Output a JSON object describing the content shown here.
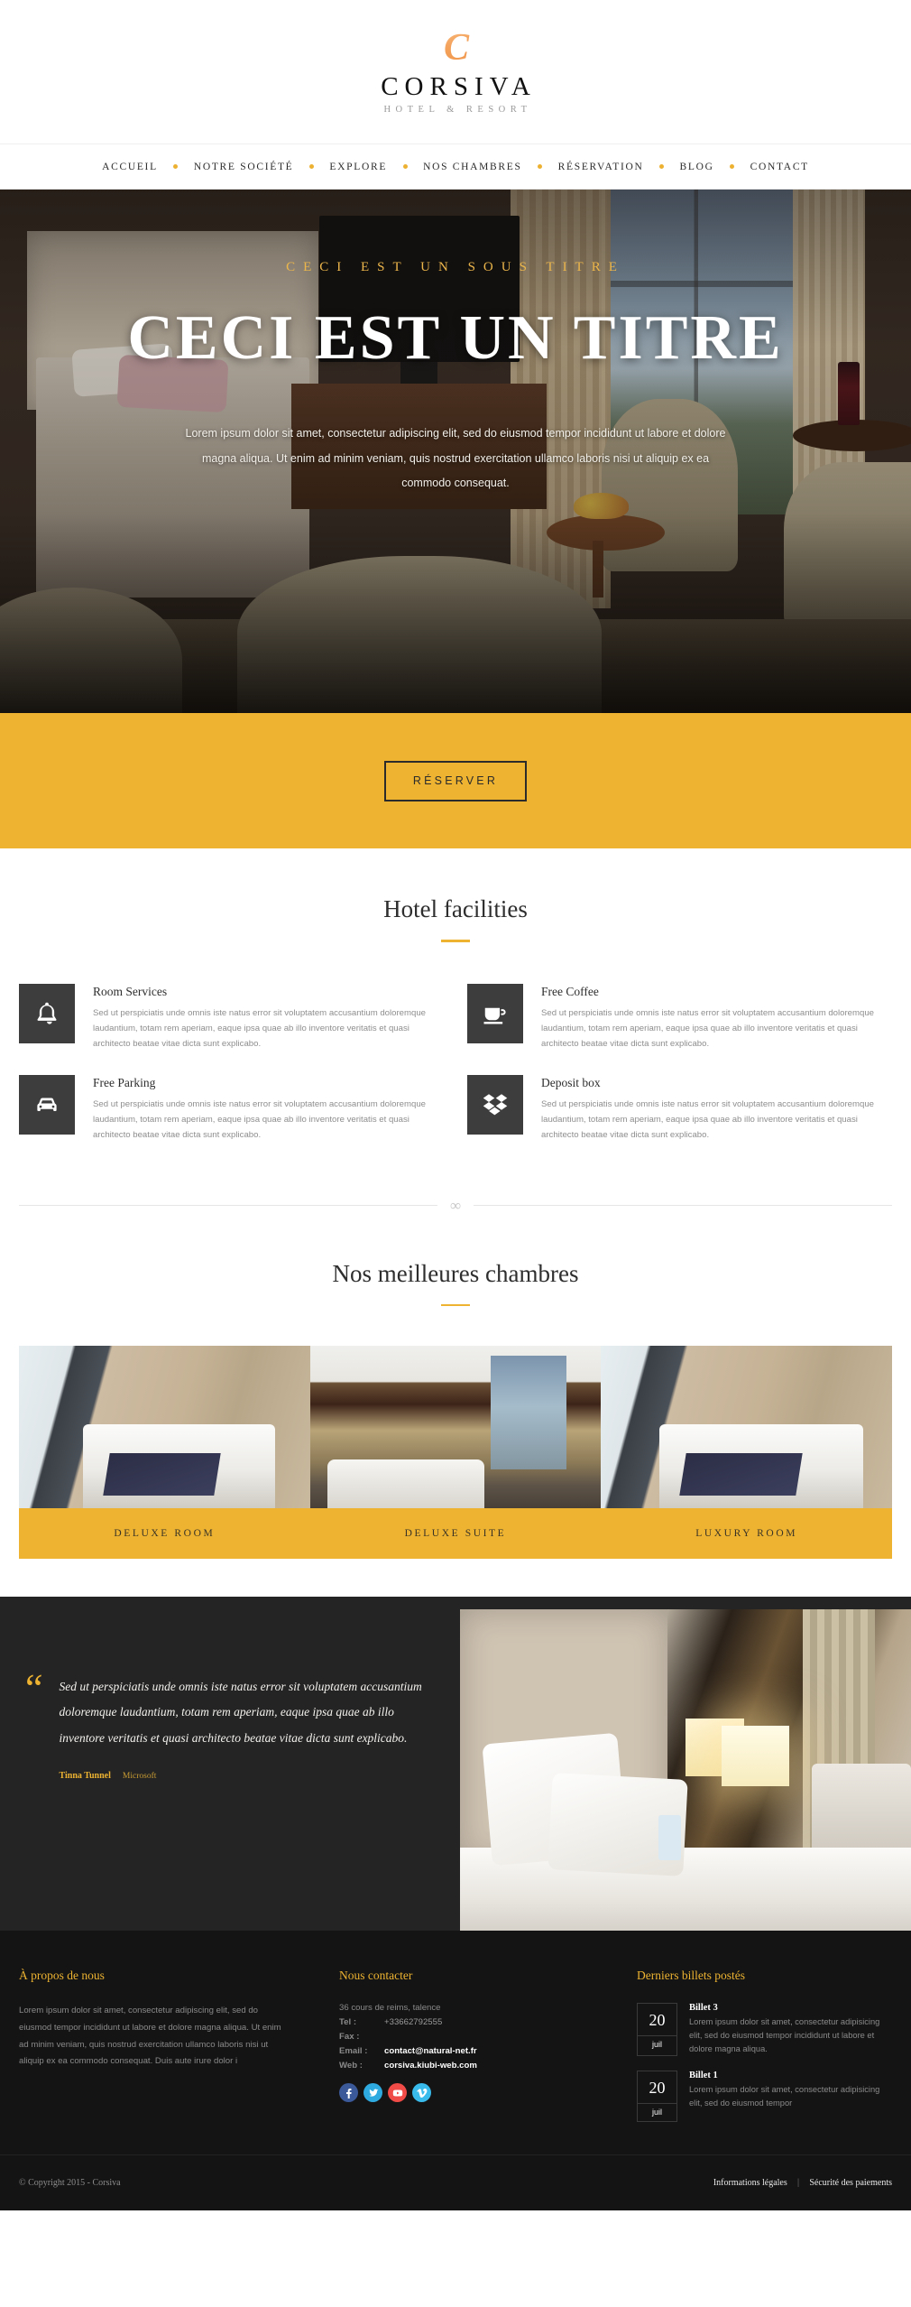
{
  "header": {
    "logo_mark": "C",
    "brand_name": "CORSIVA",
    "brand_tagline": "HOTEL & RESORT"
  },
  "nav": {
    "items": [
      {
        "label": "ACCUEIL"
      },
      {
        "label": "NOTRE SOCIÉTÉ"
      },
      {
        "label": "EXPLORE"
      },
      {
        "label": "NOS CHAMBRES"
      },
      {
        "label": "RÉSERVATION"
      },
      {
        "label": "BLOG"
      },
      {
        "label": "CONTACT"
      }
    ]
  },
  "hero": {
    "subtitle": "CECI EST UN SOUS TITRE",
    "title": "CECI EST UN TITRE",
    "text": "Lorem ipsum dolor sit amet, consectetur adipiscing elit, sed do eiusmod tempor incididunt ut labore et dolore magna aliqua. Ut enim ad minim veniam, quis nostrud exercitation ullamco laboris nisi ut aliquip ex ea commodo consequat."
  },
  "cta": {
    "reserve_label": "RÉSERVER"
  },
  "facilities": {
    "title": "Hotel facilities",
    "items": [
      {
        "icon": "bell-icon",
        "title": "Room Services",
        "text": "Sed ut perspiciatis unde omnis iste natus error sit voluptatem accusantium doloremque laudantium, totam rem aperiam, eaque ipsa quae ab illo inventore veritatis et quasi architecto beatae vitae dicta sunt explicabo."
      },
      {
        "icon": "coffee-cup-icon",
        "title": "Free Coffee",
        "text": "Sed ut perspiciatis unde omnis iste natus error sit voluptatem accusantium doloremque laudantium, totam rem aperiam, eaque ipsa quae ab illo inventore veritatis et quasi architecto beatae vitae dicta sunt explicabo."
      },
      {
        "icon": "car-icon",
        "title": "Free Parking",
        "text": "Sed ut perspiciatis unde omnis iste natus error sit voluptatem accusantium doloremque laudantium, totam rem aperiam, eaque ipsa quae ab illo inventore veritatis et quasi architecto beatae vitae dicta sunt explicabo."
      },
      {
        "icon": "deposit-box-icon",
        "title": "Deposit box",
        "text": "Sed ut perspiciatis unde omnis iste natus error sit voluptatem accusantium doloremque laudantium, totam rem aperiam, eaque ipsa quae ab illo inventore veritatis et quasi architecto beatae vitae dicta sunt explicabo."
      }
    ]
  },
  "divider": {
    "glyph": "∞"
  },
  "rooms": {
    "title": "Nos meilleures chambres",
    "items": [
      {
        "caption": "DELUXE ROOM"
      },
      {
        "caption": "DELUXE SUITE"
      },
      {
        "caption": "LUXURY ROOM"
      }
    ]
  },
  "testimonial": {
    "quote_mark": "“",
    "text": "Sed ut perspiciatis unde omnis iste natus error sit voluptatem accusantium doloremque laudantium, totam rem aperiam, eaque ipsa quae ab illo inventore veritatis et quasi architecto beatae vitae dicta sunt explicabo.",
    "author": "Tinna Tunnel",
    "company": "Microsoft"
  },
  "footer": {
    "about": {
      "title": "À propos de nous",
      "text": "Lorem ipsum dolor sit amet, consectetur adipiscing elit, sed do eiusmod tempor incididunt ut labore et dolore magna aliqua. Ut enim ad minim veniam, quis nostrud exercitation ullamco laboris nisi ut aliquip ex ea commodo consequat. Duis aute irure dolor i"
    },
    "contact": {
      "title": "Nous contacter",
      "address": "36 cours de reims, talence",
      "tel_label": "Tel :",
      "tel_value": "+33662792555",
      "fax_label": "Fax :",
      "fax_value": "",
      "email_label": "Email :",
      "email_value": "contact@natural-net.fr",
      "web_label": "Web :",
      "web_value": "corsiva.kiubi-web.com",
      "socials": [
        {
          "name": "facebook-icon",
          "color": "#3b5998"
        },
        {
          "name": "twitter-icon",
          "color": "#2eaae0"
        },
        {
          "name": "youtube-icon",
          "color": "#f04b46"
        },
        {
          "name": "vimeo-icon",
          "color": "#39bbec"
        }
      ]
    },
    "posts": {
      "title": "Derniers billets postés",
      "items": [
        {
          "day": "20",
          "month": "juil",
          "title": "Billet 3",
          "excerpt": "Lorem ipsum dolor sit amet, consectetur adipisicing elit, sed do eiusmod tempor incididunt ut labore et dolore magna aliqua."
        },
        {
          "day": "20",
          "month": "juil",
          "title": "Billet 1",
          "excerpt": "Lorem ipsum dolor sit amet, consectetur adipisicing elit, sed do eiusmod tempor"
        }
      ]
    },
    "bottom": {
      "copyright": "© Copyright 2015 - Corsiva",
      "links": [
        {
          "label": "Informations légales"
        },
        {
          "label": "Sécurité des paiements"
        }
      ],
      "link_separator": "|"
    }
  },
  "colors": {
    "accent_gold": "#edb331",
    "dark_panel": "#3d3d3d",
    "footer_bg": "#141414",
    "testimonial_bg": "#242424"
  }
}
